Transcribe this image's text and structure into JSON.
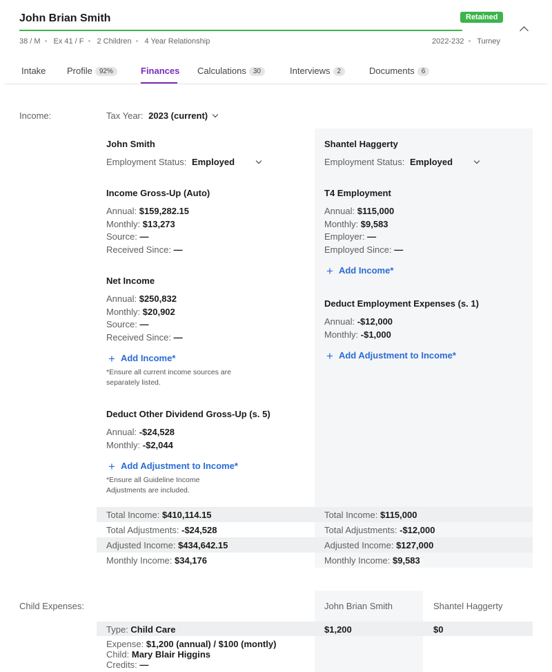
{
  "header": {
    "name": "John Brian Smith",
    "status_badge": "Retained",
    "meta": [
      "38 / M",
      "Ex 41 / F",
      "2 Children",
      "4 Year Relationship"
    ],
    "case_no": "2022-232",
    "lawyer": "Turney"
  },
  "tabs": [
    {
      "label": "Intake",
      "badge": ""
    },
    {
      "label": "Profile",
      "badge": "92%"
    },
    {
      "label": "Finances",
      "badge": ""
    },
    {
      "label": "Calculations",
      "badge": "30"
    },
    {
      "label": "Interviews",
      "badge": "2"
    },
    {
      "label": "Documents",
      "badge": "6"
    }
  ],
  "income": {
    "section_label": "Income:",
    "tax_year_label": "Tax Year:",
    "tax_year_value": "2023 (current)",
    "left": {
      "person": "John Smith",
      "employment_status_label": "Employment Status:",
      "employment_status_value": "Employed",
      "gross_up": {
        "title": "Income Gross-Up (Auto)",
        "annual_label": "Annual:",
        "annual": "$159,282.15",
        "monthly_label": "Monthly:",
        "monthly": "$13,273",
        "source_label": "Source:",
        "source": "—",
        "received_label": "Received Since:",
        "received": "—"
      },
      "net": {
        "title": "Net Income",
        "annual_label": "Annual:",
        "annual": "$250,832",
        "monthly_label": "Monthly:",
        "monthly": "$20,902",
        "source_label": "Source:",
        "source": "—",
        "received_label": "Received Since:",
        "received": "—"
      },
      "add_income": "Add Income*",
      "add_income_note": "*Ensure all current income sources are separately listed.",
      "dividend": {
        "title": "Deduct Other Dividend Gross-Up (s. 5)",
        "annual_label": "Annual:",
        "annual": "-$24,528",
        "monthly_label": "Monthly:",
        "monthly": "-$2,044"
      },
      "add_adjustment": "Add Adjustment to Income*",
      "add_adjustment_note": "*Ensure all Guideline Income Adjustments are included.",
      "totals": {
        "total_income_label": "Total Income:",
        "total_income": "$410,114.15",
        "total_adj_label": "Total Adjustments:",
        "total_adj": "-$24,528",
        "adjusted_label": "Adjusted Income:",
        "adjusted": "$434,642.15",
        "monthly_label": "Monthly Income:",
        "monthly": "$34,176"
      }
    },
    "right": {
      "person": "Shantel Haggerty",
      "employment_status_label": "Employment Status:",
      "employment_status_value": "Employed",
      "t4": {
        "title": "T4 Employment",
        "annual_label": "Annual:",
        "annual": "$115,000",
        "monthly_label": "Monthly:",
        "monthly": "$9,583",
        "employer_label": "Employer:",
        "employer": "—",
        "since_label": "Employed Since:",
        "since": "—"
      },
      "add_income": "Add Income*",
      "deduct": {
        "title": "Deduct Employment Expenses (s. 1)",
        "annual_label": "Annual:",
        "annual": "-$12,000",
        "monthly_label": "Monthly:",
        "monthly": "-$1,000"
      },
      "add_adjustment": "Add Adjustment to Income*",
      "totals": {
        "total_income_label": "Total Income:",
        "total_income": "$115,000",
        "total_adj_label": "Total Adjustments:",
        "total_adj": "-$12,000",
        "adjusted_label": "Adjusted Income:",
        "adjusted": "$127,000",
        "monthly_label": "Monthly Income:",
        "monthly": "$9,583"
      }
    }
  },
  "child_expenses": {
    "section_label": "Child Expenses:",
    "col_left": "John Brian Smith",
    "col_right": "Shantel Haggerty",
    "type_label": "Type:",
    "type": "Child Care",
    "left_amount": "$1,200",
    "right_amount": "$0",
    "expense_label": "Expense:",
    "expense": "$1,200 (annual) / $100 (montly)",
    "child_label": "Child:",
    "child": "Mary Blair Higgins",
    "credits_label": "Credits:",
    "credits": "—"
  },
  "colors": {
    "accent": "#7b2cbf",
    "retained": "#3cb44b",
    "link": "#2a6bd6",
    "panel": "#f5f6f7"
  }
}
